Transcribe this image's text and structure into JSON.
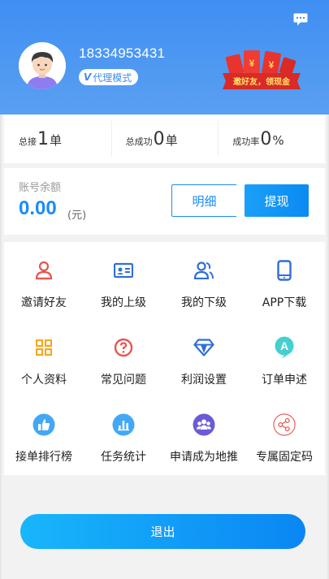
{
  "header": {
    "phone": "18334953431",
    "mode_badge": "代理模式",
    "badge_v": "V",
    "promo_text": "邀好友，领现金",
    "promo_symbol": "¥"
  },
  "stats": [
    {
      "label": "总接",
      "value": "1",
      "unit": "单"
    },
    {
      "label": "总成功",
      "value": "0",
      "unit": "单"
    },
    {
      "label": "成功率",
      "value": "0",
      "unit": "%"
    }
  ],
  "balance": {
    "title": "账号余额",
    "amount": "0.00",
    "unit": "(元)",
    "detail_label": "明细",
    "withdraw_label": "提现"
  },
  "menu": [
    {
      "label": "邀请好友",
      "icon": "invite-user-icon",
      "color": "#e8554e"
    },
    {
      "label": "我的上级",
      "icon": "id-card-icon",
      "color": "#2f6fd8"
    },
    {
      "label": "我的下级",
      "icon": "users-icon",
      "color": "#2f6fd8"
    },
    {
      "label": "APP下载",
      "icon": "phone-icon",
      "color": "#2f6fd8"
    },
    {
      "label": "个人资料",
      "icon": "grid-icon",
      "color": "#f5a623"
    },
    {
      "label": "常见问题",
      "icon": "question-icon",
      "color": "#e8554e"
    },
    {
      "label": "利润设置",
      "icon": "diamond-icon",
      "color": "#2f6fd8"
    },
    {
      "label": "订单申述",
      "icon": "appeal-icon",
      "color": "#3cc8c8"
    },
    {
      "label": "接单排行榜",
      "icon": "thumb-up-icon",
      "color": "#3aa0f2"
    },
    {
      "label": "任务统计",
      "icon": "bar-chart-icon",
      "color": "#3aa0f2"
    },
    {
      "label": "申请成为地推",
      "icon": "team-icon",
      "color": "#6a5bd8"
    },
    {
      "label": "专属固定码",
      "icon": "share-icon",
      "color": "#e8554e"
    }
  ],
  "logout_label": "退出"
}
